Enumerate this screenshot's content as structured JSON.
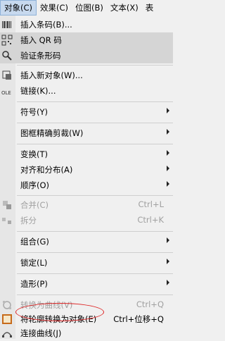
{
  "menubar": [
    {
      "label": "对象(C)",
      "active": true
    },
    {
      "label": "效果(C)"
    },
    {
      "label": "位图(B)"
    },
    {
      "label": "文本(X)"
    },
    {
      "label": "表"
    }
  ],
  "menu": {
    "insert_barcode": "插入条码(B)...",
    "insert_qr": "插入 QR 码",
    "verify_barcode": "验证条形码",
    "insert_new_object": "插入新对象(W)...",
    "link": "链接(K)...",
    "symbol": "符号(Y)",
    "powerclip": "图框精确剪裁(W)",
    "transform": "变换(T)",
    "align_distribute": "对齐和分布(A)",
    "order": "顺序(O)",
    "combine": "合并(C)",
    "combine_shortcut": "Ctrl+L",
    "break_apart": "拆分",
    "break_apart_shortcut": "Ctrl+K",
    "group": "组合(G)",
    "lock": "锁定(L)",
    "shaping": "造形(P)",
    "convert_to_curves": "转换为曲线(V)",
    "convert_to_curves_shortcut": "Ctrl+Q",
    "outline_to_object": "将轮廓转换为对象(E)",
    "outline_to_object_shortcut": "Ctrl+位移+Q",
    "connect_curves": "连接曲线(J)"
  },
  "colors": {
    "highlight": "#d5d5d5",
    "annotation": "#dd2222"
  }
}
